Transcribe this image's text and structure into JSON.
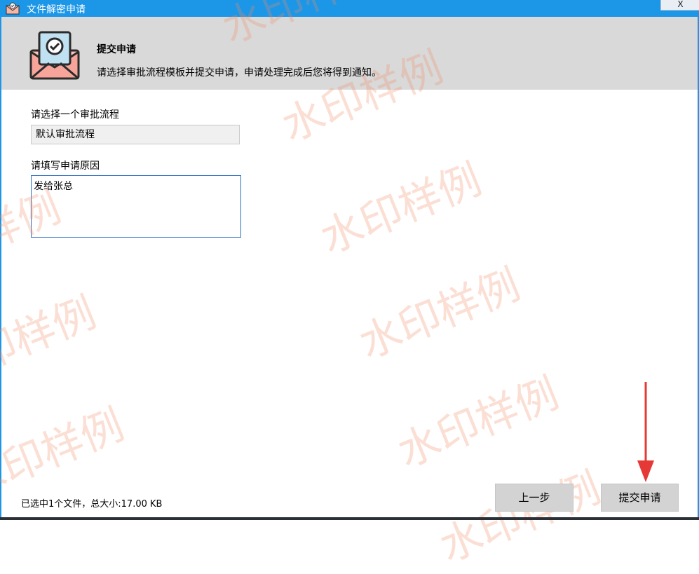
{
  "window": {
    "title": "文件解密申请",
    "close_label": "X"
  },
  "header": {
    "title": "提交申请",
    "description": "请选择审批流程模板并提交申请，申请处理完成后您将得到通知。"
  },
  "form": {
    "workflow_label": "请选择一个审批流程",
    "workflow_value": "默认审批流程",
    "reason_label": "请填写申请原因",
    "reason_value": "发给张总"
  },
  "footer": {
    "status": "已选中1个文件，总大小:17.00 KB",
    "prev_button": "上一步",
    "submit_button": "提交申请"
  },
  "watermark": {
    "text": "水印样例"
  },
  "colors": {
    "titlebar": "#1c96e7",
    "header_bg": "#d9d9d9",
    "button_bg": "#d3d3d3",
    "arrow": "#e53935"
  }
}
